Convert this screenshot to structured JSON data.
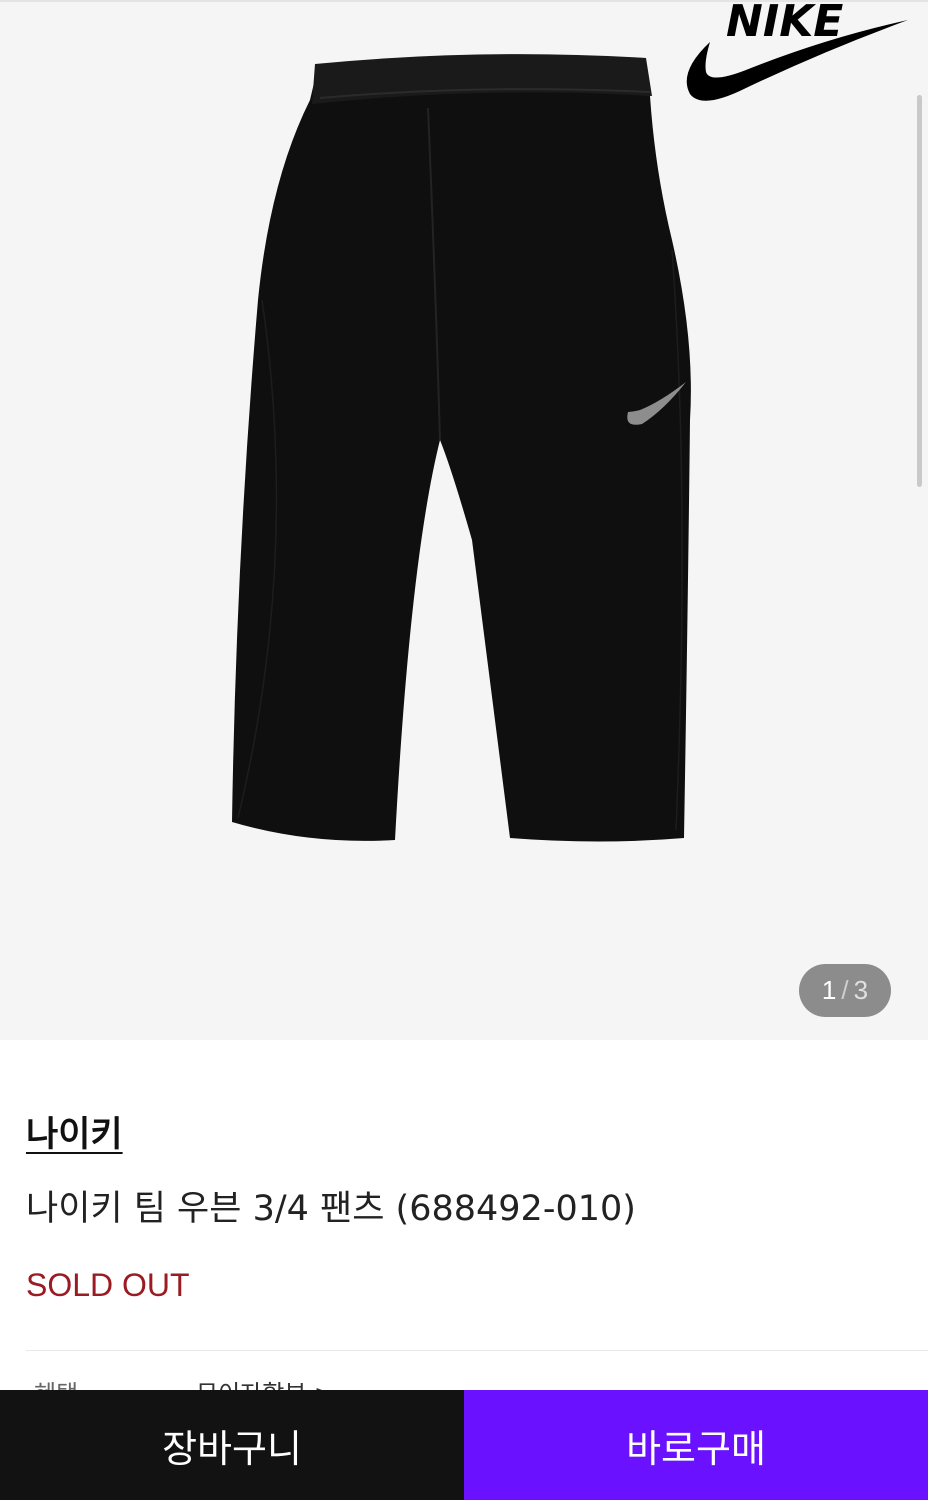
{
  "gallery": {
    "current_index": "1",
    "separator": "/",
    "total": "3",
    "brand_logo_text": "NIKE"
  },
  "product": {
    "brand": "나이키",
    "title": "나이키 팀 우븐 3/4 팬츠 (688492-010)",
    "status": "SOLD OUT",
    "status_color": "#9b1b22"
  },
  "benefits": {
    "label": "혜택",
    "link_text": "무이자할부 >"
  },
  "actions": {
    "cart_label": "장바구니",
    "buy_label": "바로구매",
    "cart_color": "#121212",
    "buy_color": "#6a11ff"
  }
}
